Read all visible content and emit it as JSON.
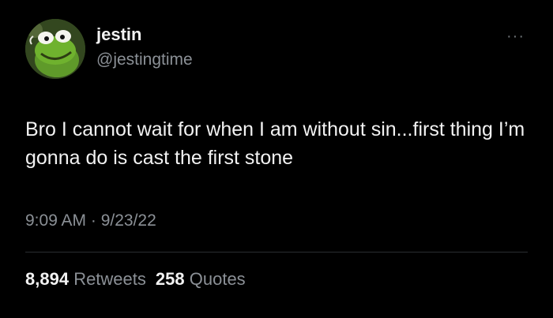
{
  "tweet": {
    "display_name": "jestin",
    "handle": "@jestingtime",
    "avatar_icon": "kermit-avatar",
    "more_label": "···",
    "text": "Bro I cannot wait for when I am without sin...first thing I’m gonna do is cast the first stone",
    "timestamp": "9:09 AM · 9/23/22",
    "stats": {
      "retweets_count": "8,894",
      "retweets_label": "Retweets",
      "quotes_count": "258",
      "quotes_label": "Quotes"
    }
  },
  "colors": {
    "background": "#000000",
    "primary_text": "#f2f2f2",
    "secondary_text": "#8b9096",
    "divider": "#2a2d30"
  }
}
